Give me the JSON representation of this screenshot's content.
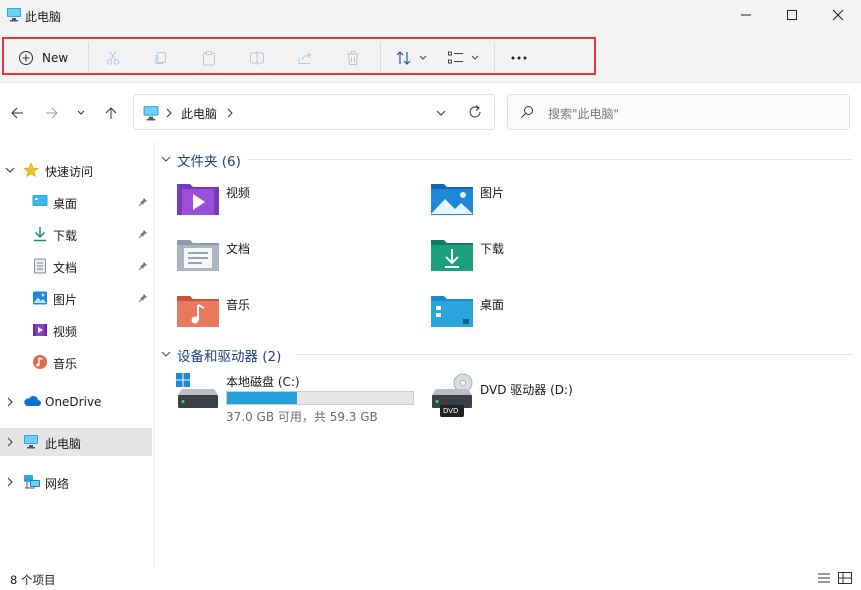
{
  "window": {
    "title": "此电脑",
    "controls": {
      "minimize": "minimize-icon",
      "maximize": "maximize-icon",
      "close": "close-icon"
    }
  },
  "toolbar": {
    "new_label": "New",
    "buttons": [
      "cut",
      "copy",
      "paste",
      "rename",
      "share",
      "delete",
      "sort",
      "view",
      "more"
    ],
    "highlight_color": "#e53935"
  },
  "address": {
    "breadcrumb": "此电脑",
    "search_placeholder": "搜索\"此电脑\""
  },
  "sidebar": {
    "quick_access": "快速访问",
    "items": [
      {
        "label": "桌面",
        "pinned": true
      },
      {
        "label": "下载",
        "pinned": true
      },
      {
        "label": "文档",
        "pinned": true
      },
      {
        "label": "图片",
        "pinned": true
      },
      {
        "label": "视频",
        "pinned": false
      },
      {
        "label": "音乐",
        "pinned": false
      }
    ],
    "onedrive": "OneDrive",
    "this_pc": "此电脑",
    "network": "网络",
    "selected_bg": "#e5e5e5"
  },
  "main": {
    "folders_header": "文件夹 (6)",
    "folders": [
      {
        "label": "视频",
        "icon": "videos-folder-icon"
      },
      {
        "label": "图片",
        "icon": "pictures-folder-icon"
      },
      {
        "label": "文档",
        "icon": "documents-folder-icon"
      },
      {
        "label": "下载",
        "icon": "downloads-folder-icon"
      },
      {
        "label": "音乐",
        "icon": "music-folder-icon"
      },
      {
        "label": "桌面",
        "icon": "desktop-folder-icon"
      }
    ],
    "devices_header": "设备和驱动器 (2)",
    "drives": [
      {
        "label": "本地磁盘 (C:)",
        "usage": "37.0 GB 可用，共 59.3 GB",
        "used_fraction": 0.376
      },
      {
        "label": "DVD 驱动器 (D:)",
        "badge": "DVD"
      }
    ],
    "header_color": "#1e3f8a",
    "bar_color": "#26a0da"
  },
  "status": {
    "item_count": "8 个项目"
  }
}
